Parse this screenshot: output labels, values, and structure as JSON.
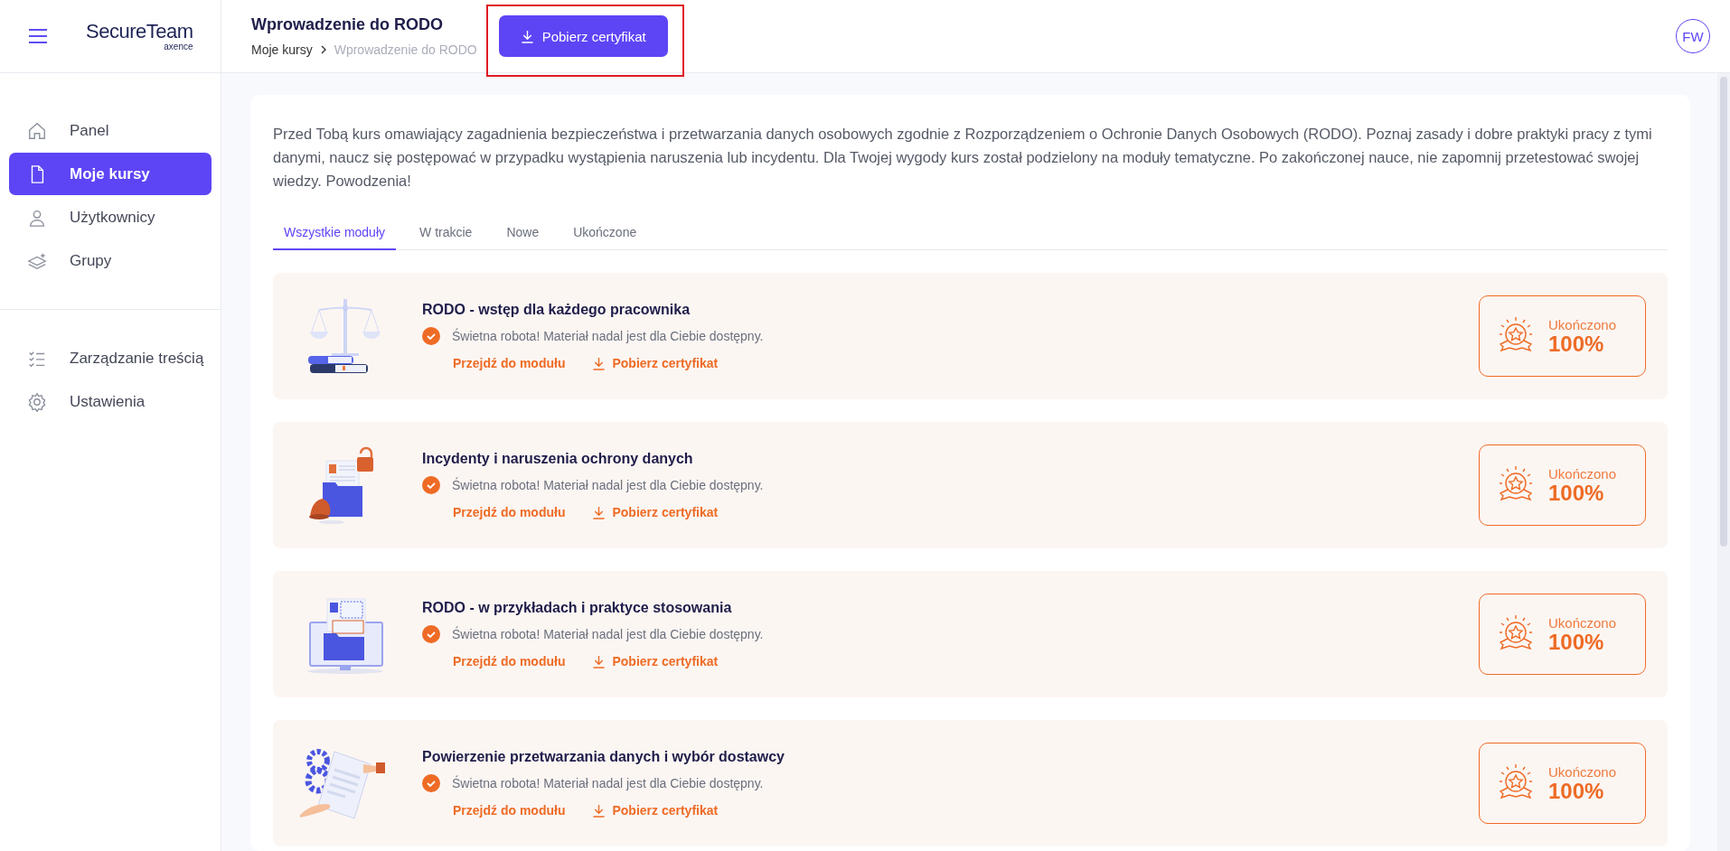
{
  "brand": {
    "name": "SecureTeam",
    "sub": "axence"
  },
  "header": {
    "title": "Wprowadzenie do RODO",
    "breadcrumb": [
      {
        "label": "Moje kursy",
        "current": false
      },
      {
        "label": "Wprowadzenie do RODO",
        "current": true
      }
    ],
    "button": "Pobierz certyfikat",
    "button_highlighted": true,
    "avatar": "FW"
  },
  "sidebar": {
    "items": [
      {
        "label": "Panel",
        "selected": false
      },
      {
        "label": "Moje kursy",
        "selected": true
      },
      {
        "label": "Użytkownicy",
        "selected": false
      },
      {
        "label": "Grupy",
        "selected": false
      },
      {
        "label": "Zarządzanie treścią",
        "selected": false
      },
      {
        "label": "Ustawienia",
        "selected": false
      }
    ]
  },
  "intro": "Przed Tobą kurs omawiający zagadnienia bezpieczeństwa i przetwarzania danych osobowych zgodnie z Rozporządzeniem o Ochronie Danych Osobowych (RODO). Poznaj zasady i dobre praktyki pracy z tymi danymi, naucz się postępować w przypadku wystąpienia naruszenia lub incydentu. Dla Twojej wygody kurs został podzielony na moduły tematyczne. Po zakończonej nauce, nie zapomnij przetestować swojej wiedzy. Powodzenia!",
  "tabs": [
    {
      "label": "Wszystkie moduły",
      "selected": true
    },
    {
      "label": "W trakcie",
      "selected": false
    },
    {
      "label": "Nowe",
      "selected": false
    },
    {
      "label": "Ukończone",
      "selected": false
    }
  ],
  "modules": [
    {
      "kind": "scales",
      "title": "RODO - wstęp dla każdego pracownika",
      "completed": true,
      "status": "Świetna robota! Materiał nadal jest dla Ciebie dostępny.",
      "link": "Przejdź do modułu",
      "certificate": "Pobierz certyfikat",
      "badge_label": "Ukończono",
      "badge_value": "100%"
    },
    {
      "kind": "folder-bell",
      "title": "Incydenty i naruszenia ochrony danych",
      "completed": true,
      "status": "Świetna robota! Materiał nadal jest dla Ciebie dostępny.",
      "link": "Przejdź do modułu",
      "certificate": "Pobierz certyfikat",
      "badge_label": "Ukończono",
      "badge_value": "100%"
    },
    {
      "kind": "monitor",
      "title": "RODO - w przykładach i praktyce stosowania",
      "completed": true,
      "status": "Świetna robota! Materiał nadal jest dla Ciebie dostępny.",
      "link": "Przejdź do modułu",
      "certificate": "Pobierz certyfikat",
      "badge_label": "Ukończono",
      "badge_value": "100%"
    },
    {
      "kind": "gears",
      "title": "Powierzenie przetwarzania danych i wybór dostawcy",
      "completed": true,
      "status": "Świetna robota! Materiał nadal jest dla Ciebie dostępny.",
      "link": "Przejdź do modułu",
      "certificate": "Pobierz certyfikat",
      "badge_label": "Ukończono",
      "badge_value": "100%"
    }
  ]
}
